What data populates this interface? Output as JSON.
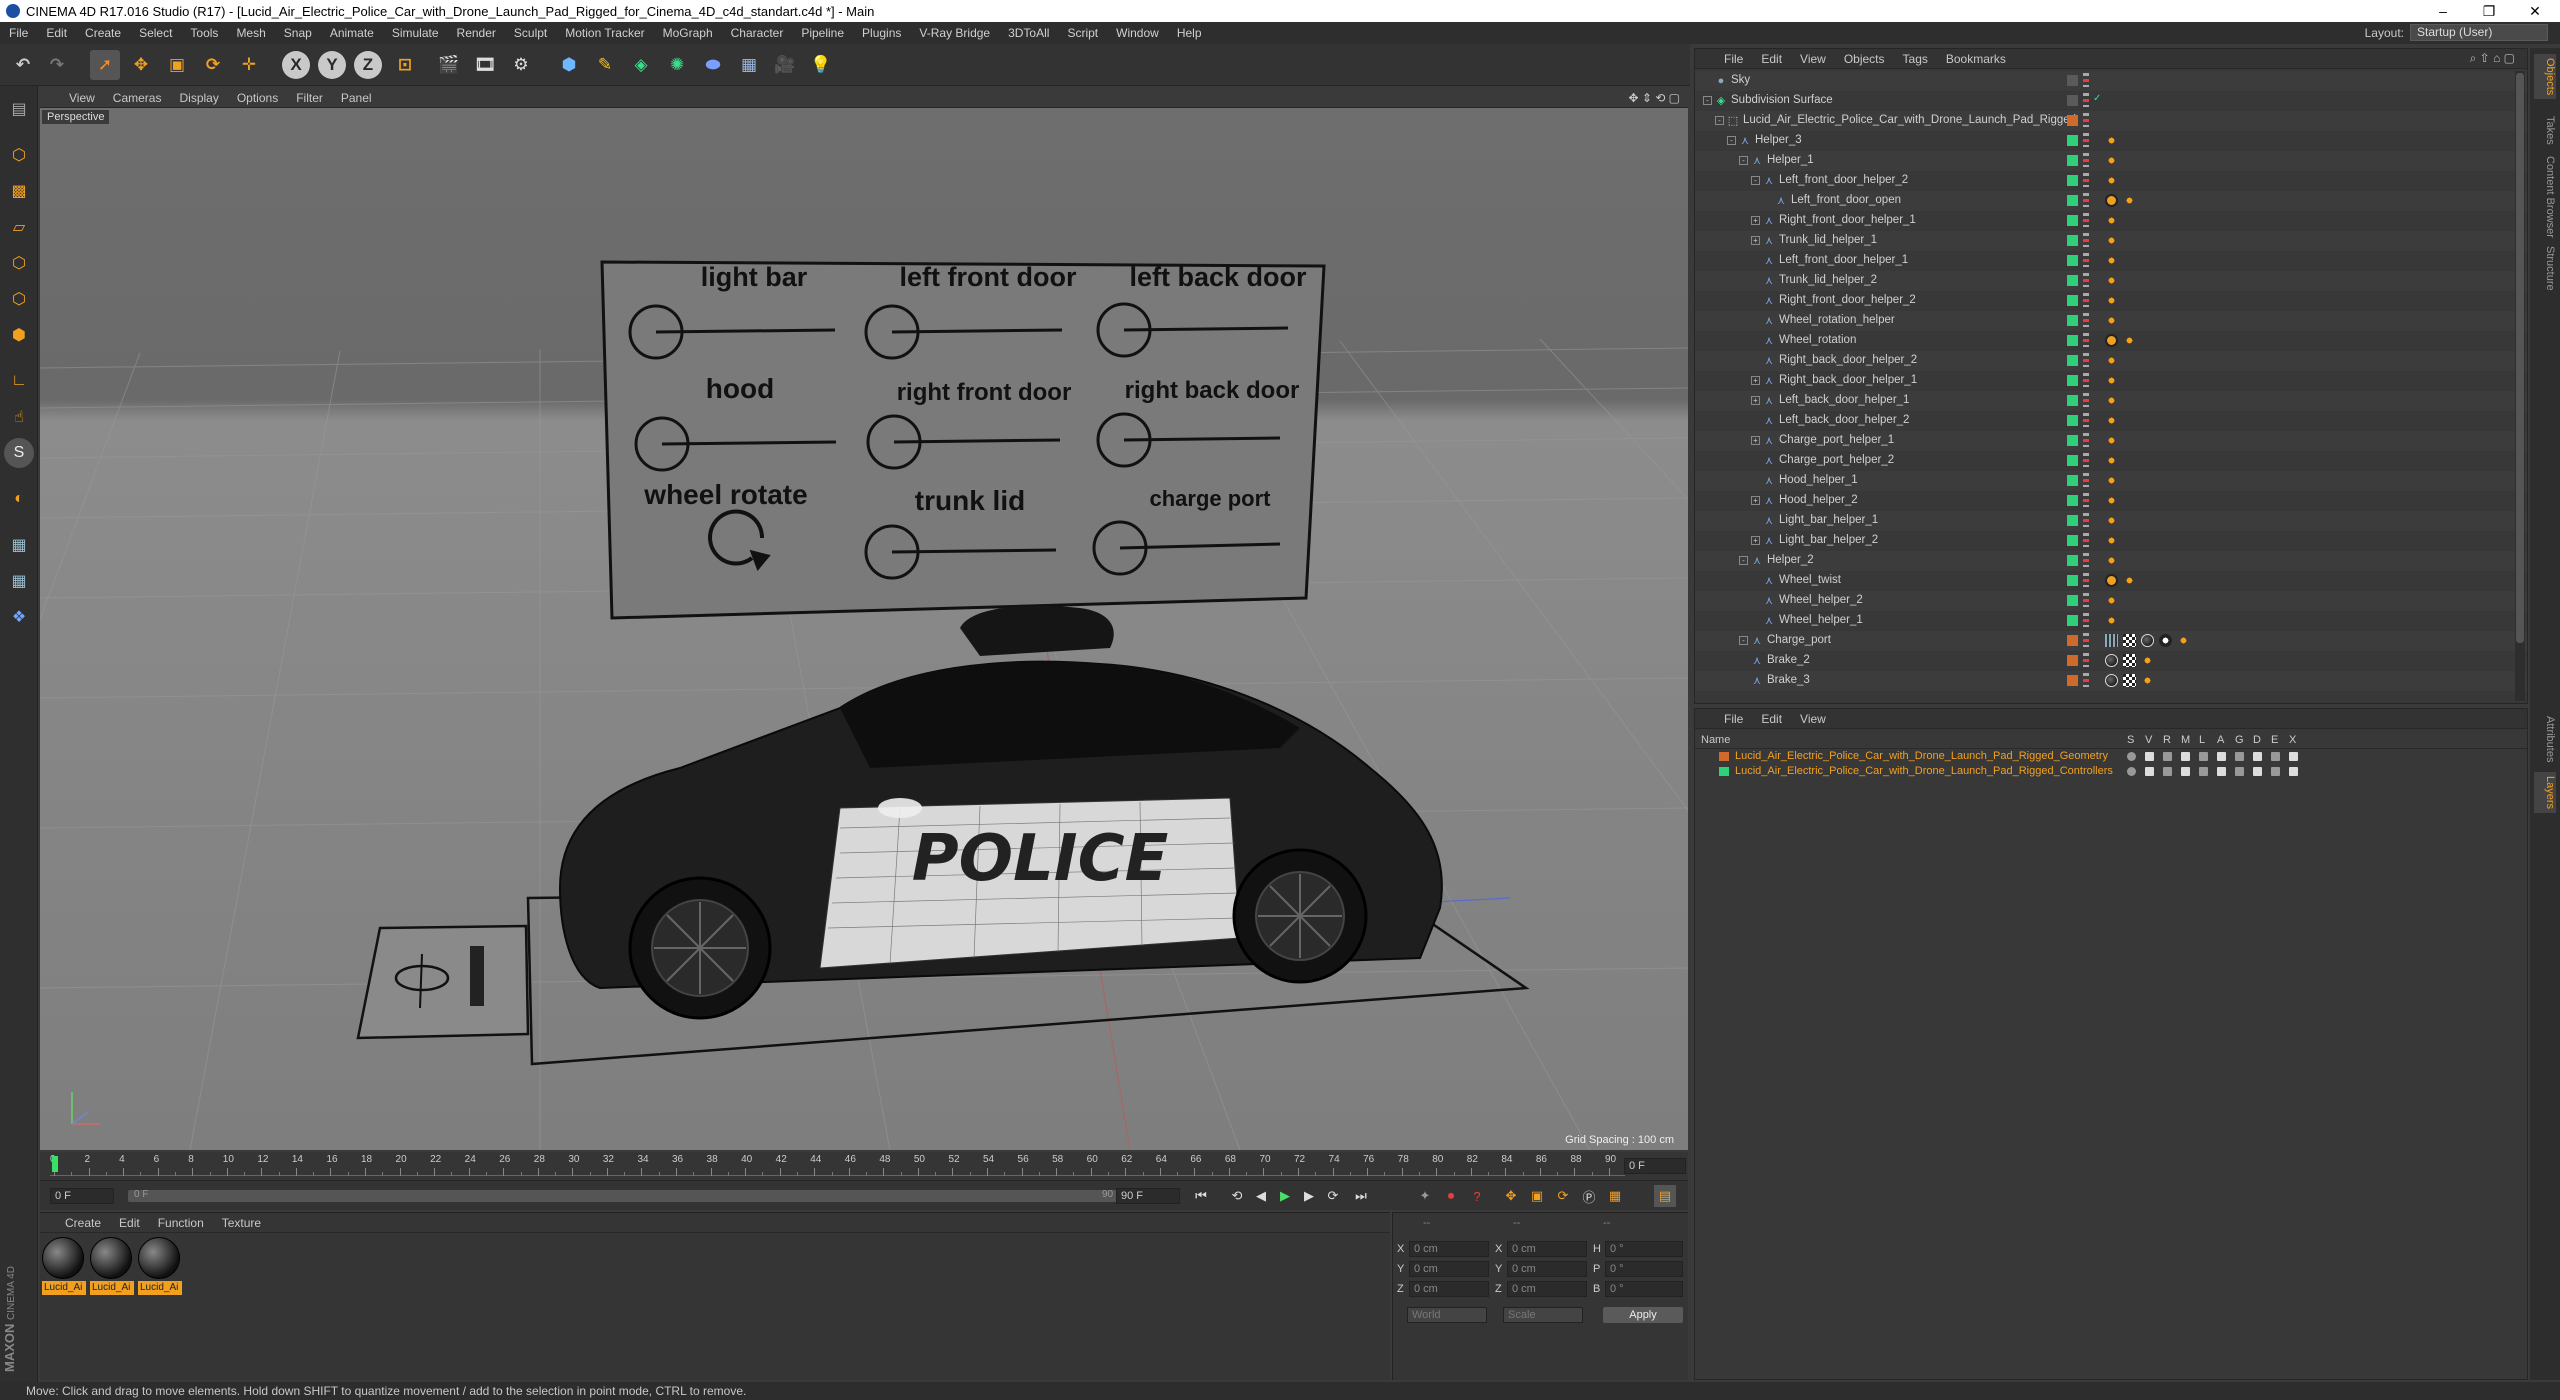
{
  "window": {
    "title": "CINEMA 4D R17.016 Studio (R17) - [Lucid_Air_Electric_Police_Car_with_Drone_Launch_Pad_Rigged_for_Cinema_4D_c4d_standart.c4d *] - Main",
    "minimize": "–",
    "maximize": "❐",
    "close": "✕"
  },
  "menubar": [
    "File",
    "Edit",
    "Create",
    "Select",
    "Tools",
    "Mesh",
    "Snap",
    "Animate",
    "Simulate",
    "Render",
    "Sculpt",
    "Motion Tracker",
    "MoGraph",
    "Character",
    "Pipeline",
    "Plugins",
    "V-Ray Bridge",
    "3DToAll",
    "Script",
    "Window",
    "Help"
  ],
  "layout": {
    "label": "Layout:",
    "value": "Startup (User)"
  },
  "toolbar": {
    "axis_x": "X",
    "axis_y": "Y",
    "axis_z": "Z"
  },
  "viewport": {
    "menu": [
      "View",
      "Cameras",
      "Display",
      "Options",
      "Filter",
      "Panel"
    ],
    "camera_label": "Perspective",
    "grid_spacing": "Grid Spacing : 100 cm",
    "control_board": {
      "row1": [
        "light bar",
        "left front door",
        "left back door"
      ],
      "row2": [
        "hood",
        "right front door",
        "right back door"
      ],
      "row3": [
        "wheel rotate",
        "trunk lid",
        "charge port"
      ]
    },
    "car_text": "POLICE"
  },
  "timeline": {
    "ticks": [
      "0",
      "2",
      "4",
      "6",
      "8",
      "10",
      "12",
      "14",
      "16",
      "18",
      "20",
      "22",
      "24",
      "26",
      "28",
      "30",
      "32",
      "34",
      "36",
      "38",
      "40",
      "42",
      "44",
      "46",
      "48",
      "50",
      "52",
      "54",
      "56",
      "58",
      "60",
      "62",
      "64",
      "66",
      "68",
      "70",
      "72",
      "74",
      "76",
      "78",
      "80",
      "82",
      "84",
      "86",
      "88",
      "90"
    ],
    "current_frame": "0 F",
    "start_frame": "0 F",
    "slider_start": "0 F",
    "slider_end": "90 F",
    "end_frame": "90 F"
  },
  "materials": {
    "menu": [
      "Create",
      "Edit",
      "Function",
      "Texture"
    ],
    "items": [
      "Lucid_Ai",
      "Lucid_Ai",
      "Lucid_Ai"
    ],
    "brand": "MAXON",
    "brand_sub": "CINEMA 4D"
  },
  "coords": {
    "header_dashes": [
      "--",
      "--",
      "--"
    ],
    "rows": [
      {
        "a": "X",
        "av": "0 cm",
        "b": "X",
        "bv": "0 cm",
        "c": "H",
        "cv": "0 °"
      },
      {
        "a": "Y",
        "av": "0 cm",
        "b": "Y",
        "bv": "0 cm",
        "c": "P",
        "cv": "0 °"
      },
      {
        "a": "Z",
        "av": "0 cm",
        "b": "Z",
        "bv": "0 cm",
        "c": "B",
        "cv": "0 °"
      }
    ],
    "mode1": "World",
    "mode2": "Scale",
    "apply": "Apply"
  },
  "status": "Move: Click and drag to move elements. Hold down SHIFT to quantize movement / add to the selection in point mode, CTRL to remove.",
  "object_manager": {
    "menu": [
      "File",
      "Edit",
      "View",
      "Objects",
      "Tags",
      "Bookmarks"
    ],
    "items": [
      {
        "name": "Sky",
        "indent": 0,
        "exp": "",
        "color": "none",
        "icon": "sky"
      },
      {
        "name": "Subdivision Surface",
        "indent": 0,
        "exp": "-",
        "color": "none",
        "icon": "subd",
        "check": "✓"
      },
      {
        "name": "Lucid_Air_Electric_Police_Car_with_Drone_Launch_Pad_Rigged",
        "indent": 1,
        "exp": "-",
        "color": "#d06a2a",
        "icon": "null"
      },
      {
        "name": "Helper_3",
        "indent": 2,
        "exp": "-",
        "color": "#2ed07a",
        "icon": "joint",
        "tags": [
          "o"
        ]
      },
      {
        "name": "Helper_1",
        "indent": 3,
        "exp": "-",
        "color": "#2ed07a",
        "icon": "joint",
        "tags": [
          "o"
        ]
      },
      {
        "name": "Left_front_door_helper_2",
        "indent": 4,
        "exp": "-",
        "color": "#2ed07a",
        "icon": "joint",
        "tags": [
          "o"
        ]
      },
      {
        "name": "Left_front_door_open",
        "indent": 5,
        "exp": "",
        "color": "#2ed07a",
        "icon": "joint",
        "tags": [
          "x",
          "o"
        ]
      },
      {
        "name": "Right_front_door_helper_1",
        "indent": 4,
        "exp": "+",
        "color": "#2ed07a",
        "icon": "joint",
        "tags": [
          "o"
        ]
      },
      {
        "name": "Trunk_lid_helper_1",
        "indent": 4,
        "exp": "+",
        "color": "#2ed07a",
        "icon": "joint",
        "tags": [
          "o"
        ]
      },
      {
        "name": "Left_front_door_helper_1",
        "indent": 4,
        "exp": "",
        "color": "#2ed07a",
        "icon": "joint",
        "tags": [
          "o"
        ]
      },
      {
        "name": "Trunk_lid_helper_2",
        "indent": 4,
        "exp": "",
        "color": "#2ed07a",
        "icon": "joint",
        "tags": [
          "o"
        ]
      },
      {
        "name": "Right_front_door_helper_2",
        "indent": 4,
        "exp": "",
        "color": "#2ed07a",
        "icon": "joint",
        "tags": [
          "o"
        ]
      },
      {
        "name": "Wheel_rotation_helper",
        "indent": 4,
        "exp": "",
        "color": "#2ed07a",
        "icon": "joint",
        "tags": [
          "o"
        ]
      },
      {
        "name": "Wheel_rotation",
        "indent": 4,
        "exp": "",
        "color": "#2ed07a",
        "icon": "joint",
        "tags": [
          "x",
          "o"
        ]
      },
      {
        "name": "Right_back_door_helper_2",
        "indent": 4,
        "exp": "",
        "color": "#2ed07a",
        "icon": "joint",
        "tags": [
          "o"
        ]
      },
      {
        "name": "Right_back_door_helper_1",
        "indent": 4,
        "exp": "+",
        "color": "#2ed07a",
        "icon": "joint",
        "tags": [
          "o"
        ]
      },
      {
        "name": "Left_back_door_helper_1",
        "indent": 4,
        "exp": "+",
        "color": "#2ed07a",
        "icon": "joint",
        "tags": [
          "o"
        ]
      },
      {
        "name": "Left_back_door_helper_2",
        "indent": 4,
        "exp": "",
        "color": "#2ed07a",
        "icon": "joint",
        "tags": [
          "o"
        ]
      },
      {
        "name": "Charge_port_helper_1",
        "indent": 4,
        "exp": "+",
        "color": "#2ed07a",
        "icon": "joint",
        "tags": [
          "o"
        ]
      },
      {
        "name": "Charge_port_helper_2",
        "indent": 4,
        "exp": "",
        "color": "#2ed07a",
        "icon": "joint",
        "tags": [
          "o"
        ]
      },
      {
        "name": "Hood_helper_1",
        "indent": 4,
        "exp": "",
        "color": "#2ed07a",
        "icon": "joint",
        "tags": [
          "o"
        ]
      },
      {
        "name": "Hood_helper_2",
        "indent": 4,
        "exp": "+",
        "color": "#2ed07a",
        "icon": "joint",
        "tags": [
          "o"
        ]
      },
      {
        "name": "Light_bar_helper_1",
        "indent": 4,
        "exp": "",
        "color": "#2ed07a",
        "icon": "joint",
        "tags": [
          "o"
        ]
      },
      {
        "name": "Light_bar_helper_2",
        "indent": 4,
        "exp": "+",
        "color": "#2ed07a",
        "icon": "joint",
        "tags": [
          "o"
        ]
      },
      {
        "name": "Helper_2",
        "indent": 3,
        "exp": "-",
        "color": "#2ed07a",
        "icon": "joint",
        "tags": [
          "o"
        ]
      },
      {
        "name": "Wheel_twist",
        "indent": 4,
        "exp": "",
        "color": "#2ed07a",
        "icon": "joint",
        "tags": [
          "x",
          "o"
        ]
      },
      {
        "name": "Wheel_helper_2",
        "indent": 4,
        "exp": "",
        "color": "#2ed07a",
        "icon": "joint",
        "tags": [
          "o"
        ]
      },
      {
        "name": "Wheel_helper_1",
        "indent": 4,
        "exp": "",
        "color": "#2ed07a",
        "icon": "joint",
        "tags": [
          "o"
        ]
      },
      {
        "name": "Charge_port",
        "indent": 3,
        "exp": "-",
        "color": "#d06a2a",
        "icon": "joint",
        "tags": [
          "g",
          "c",
          "b",
          "w",
          "o"
        ]
      },
      {
        "name": "Brake_2",
        "indent": 3,
        "exp": "",
        "color": "#d06a2a",
        "icon": "joint",
        "tags": [
          "b",
          "c",
          "o"
        ]
      },
      {
        "name": "Brake_3",
        "indent": 3,
        "exp": "",
        "color": "#d06a2a",
        "icon": "joint",
        "tags": [
          "b",
          "c",
          "o"
        ]
      }
    ]
  },
  "layer_manager": {
    "menu": [
      "File",
      "Edit",
      "View"
    ],
    "header": {
      "name": "Name",
      "cols": [
        "S",
        "V",
        "R",
        "M",
        "L",
        "A",
        "G",
        "D",
        "E",
        "X"
      ]
    },
    "layers": [
      {
        "name": "Lucid_Air_Electric_Police_Car_with_Drone_Launch_Pad_Rigged_Geometry",
        "color": "#d06a2a"
      },
      {
        "name": "Lucid_Air_Electric_Police_Car_with_Drone_Launch_Pad_Rigged_Controllers",
        "color": "#2ed07a"
      }
    ]
  },
  "right_dock": [
    "Objects",
    "Takes",
    "Content Browser",
    "Structure",
    "Attributes",
    "Layers"
  ]
}
